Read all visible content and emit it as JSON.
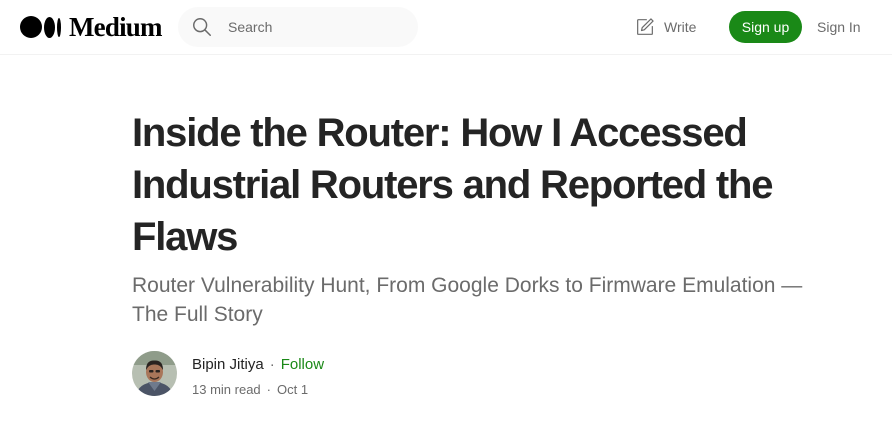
{
  "header": {
    "logo_text": "Medium",
    "search_placeholder": "Search",
    "write_label": "Write",
    "signup_label": "Sign up",
    "signin_label": "Sign In"
  },
  "article": {
    "title": "Inside the Router: How I Accessed Industrial Routers and Reported the Flaws",
    "subtitle": "Router Vulnerability Hunt, From Google Dorks to Firmware Emulation — The Full Story",
    "author": "Bipin Jitiya",
    "follow_label": "Follow",
    "separator": "·",
    "read_time": "13 min read",
    "date": "Oct 1"
  },
  "colors": {
    "accent_green": "#1a8917",
    "text_primary": "#242424",
    "text_secondary": "#6b6b6b",
    "search_bg": "#f9f9f9"
  }
}
